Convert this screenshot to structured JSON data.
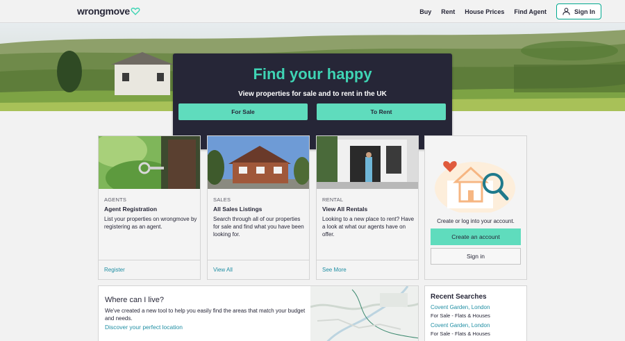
{
  "header": {
    "logo_text": "wrongmove",
    "nav": [
      "Buy",
      "Rent",
      "House Prices",
      "Find Agent"
    ],
    "signin_label": "Sign In"
  },
  "hero": {
    "title": "Find your happy",
    "subtitle": "View properties for sale and to rent in the UK",
    "for_sale_label": "For Sale",
    "to_rent_label": "To Rent"
  },
  "cards": [
    {
      "category": "AGENTS",
      "title": "Agent Registration",
      "description": "List your properties on wrongmove by registering as an agent.",
      "link": "Register"
    },
    {
      "category": "SALES",
      "title": "All Sales Listings",
      "description": "Search through all of our properties for sale and find what you have been looking for.",
      "link": "View All"
    },
    {
      "category": "RENTAL",
      "title": "View All Rentals",
      "description": "Looking to a new place to rent? Have a look at what our agents have on offer.",
      "link": "See More"
    }
  ],
  "account": {
    "text": "Create or log into your account.",
    "create_label": "Create an account",
    "signin_label": "Sign in"
  },
  "where": {
    "title": "Where can I live?",
    "description": "We've created a new tool to help you easily find the areas that match your budget and needs.",
    "link": "Discover your perfect location"
  },
  "recent": {
    "title": "Recent Searches",
    "items": [
      {
        "location": "Covent Garden, London",
        "type": "For Sale - Flats & Houses"
      },
      {
        "location": "Covent Garden, London",
        "type": "For Sale - Flats & Houses"
      }
    ]
  },
  "colors": {
    "accent": "#5fdcbd",
    "hero_title": "#3fd4b4",
    "dark": "#262637",
    "link": "#1f8ea3"
  }
}
